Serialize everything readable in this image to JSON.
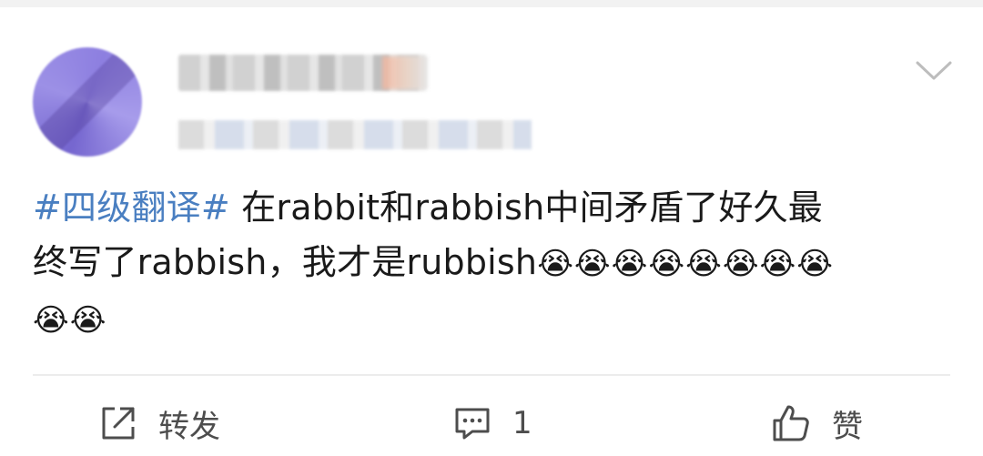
{
  "post": {
    "hashtag": "#四级翻译#",
    "text_line1": " 在rabbit和rabbish中间矛盾了好久最",
    "text_line2": "终写了rabbish，我才是rubbish",
    "emoji_row1": "😭😭😭😭😭😭😭😭",
    "emoji_row2": "😭😭"
  },
  "actions": {
    "repost_label": "转发",
    "comment_count": "1",
    "like_label": "赞"
  },
  "icons": {
    "repost": "share-square-icon",
    "comment": "comment-bubble-icon",
    "like": "thumbs-up-icon",
    "menu": "chevron-down-icon"
  },
  "colors": {
    "hashtag": "#4a7fc1",
    "text": "#1a1a1a",
    "action_text": "#4d4d4d"
  }
}
